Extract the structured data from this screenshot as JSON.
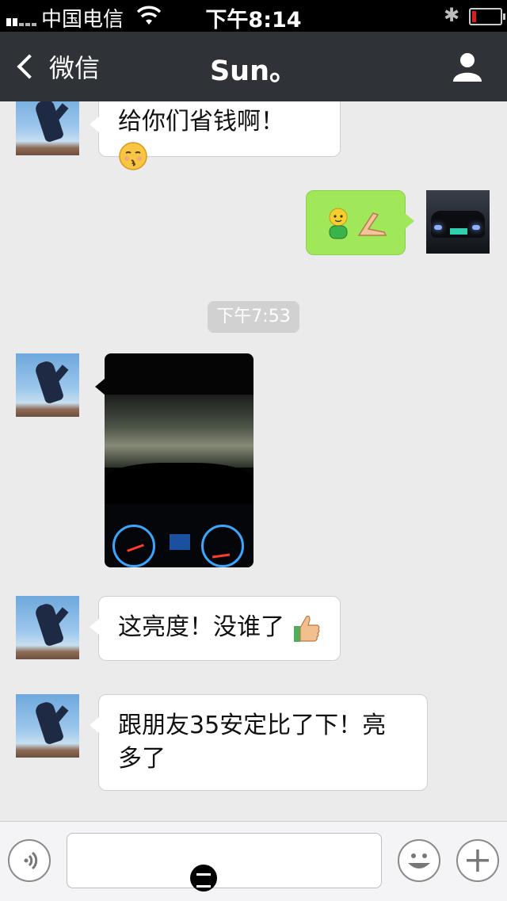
{
  "status_bar": {
    "carrier": "中国电信",
    "time": "下午8:14"
  },
  "nav": {
    "back_label": "微信",
    "title": "Sun。"
  },
  "chat": {
    "messages": [
      {
        "from": "contact",
        "text": "给你们省钱啊！"
      },
      {
        "from": "me",
        "text": ""
      },
      {
        "timestamp": "下午7:53"
      },
      {
        "from": "contact",
        "type": "photo"
      },
      {
        "from": "contact",
        "text": "这亮度！没谁了"
      },
      {
        "from": "contact",
        "text": "跟朋友35安定比了下！亮多了"
      }
    ]
  },
  "icons": {
    "back": "chevron-left-icon",
    "contact": "person-icon",
    "voice": "voice-icon",
    "emoji": "smiley-icon",
    "more": "plus-icon",
    "wifi": "wifi-icon",
    "bluetooth": "bluetooth-icon",
    "battery": "battery-low-icon"
  },
  "colors": {
    "nav_bg": "#2f3236",
    "chat_bg": "#ebebeb",
    "out_bubble": "#a0e75a",
    "battery_low": "#e01b1b"
  },
  "battery_level": 0.15
}
